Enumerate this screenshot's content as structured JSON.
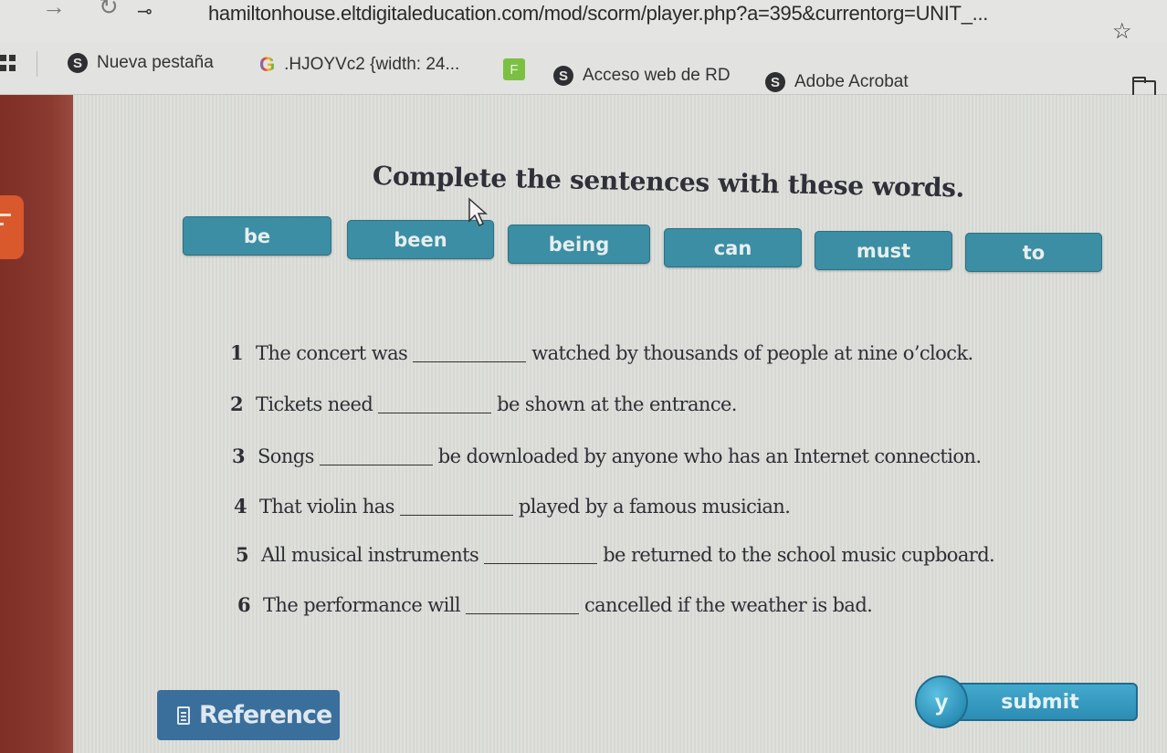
{
  "browser": {
    "url": "hamiltonhouse.eltdigitaleducation.com/mod/scorm/player.php?a=395&currentorg=UNIT_...",
    "icons": {
      "back": "back-arrow-icon",
      "reload": "reload-icon",
      "site_info": "site-settings-icon",
      "bookmark_star": "star-icon",
      "other_bookmarks": "folder-icon",
      "apps": "apps-grid-icon"
    },
    "bookmarks": [
      {
        "label": "Nueva pestaña",
        "icon": "globe-icon"
      },
      {
        "label": ".HJOYVc2 {width: 24...",
        "icon": "google-g-icon"
      },
      {
        "label": "",
        "icon": "feedly-f-icon",
        "glyph": "F"
      },
      {
        "label": "Acceso web de RD",
        "icon": "globe-icon"
      },
      {
        "label": "Adobe Acrobat",
        "icon": "globe-icon"
      }
    ]
  },
  "exercise": {
    "instructions": "Complete the sentences with these words.",
    "word_bank": [
      "be",
      "been",
      "being",
      "can",
      "must",
      "to"
    ],
    "sentences": [
      {
        "number": "1",
        "before": "The concert was",
        "after": "watched by thousands of people at nine o’clock."
      },
      {
        "number": "2",
        "before": "Tickets need",
        "after": "be shown at the entrance."
      },
      {
        "number": "3",
        "before": "Songs",
        "after": "be downloaded by anyone who has an Internet connection."
      },
      {
        "number": "4",
        "before": "That violin has",
        "after": "played by a famous musician."
      },
      {
        "number": "5",
        "before": "All musical instruments",
        "after": "be returned to the school music cupboard."
      },
      {
        "number": "6",
        "before": "The performance will",
        "after": "cancelled if the weather is bad."
      }
    ]
  },
  "footer": {
    "reference_label": "Reference",
    "submit_label": "submit",
    "submit_badge": "y"
  },
  "colors": {
    "word_button": "#3b8ea3",
    "reference_button": "#3a6f9c",
    "submit_button": "#2c8db4",
    "sidebar": "#7e2f26",
    "sidebar_tab": "#d9582c"
  }
}
